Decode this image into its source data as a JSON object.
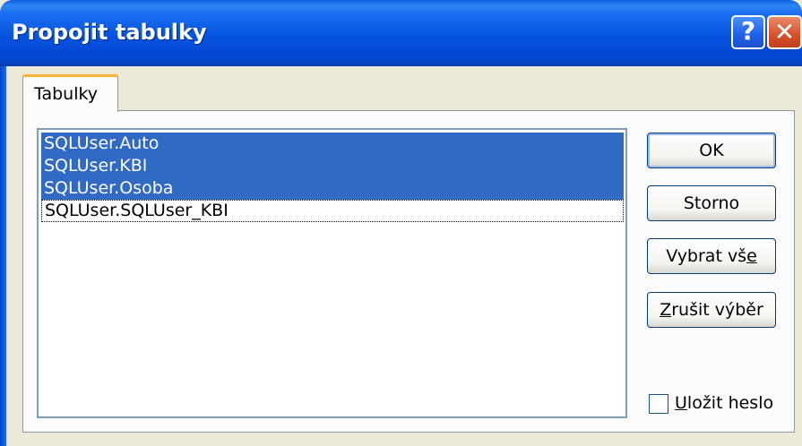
{
  "window": {
    "title": "Propojit tabulky",
    "help_glyph": "?",
    "close_glyph": "✕"
  },
  "tab": {
    "label": "Tabulky"
  },
  "list": {
    "items": [
      {
        "label": "SQLUser.Auto",
        "selected": true
      },
      {
        "label": "SQLUser.KBI",
        "selected": true
      },
      {
        "label": "SQLUser.Osoba",
        "selected": true
      },
      {
        "label": "SQLUser.SQLUser_KBI",
        "selected": false,
        "focused": true
      }
    ]
  },
  "buttons": {
    "ok": "OK",
    "cancel": "Storno",
    "select_all_pre": "Vybrat vš",
    "select_all_key": "e",
    "clear_key": "Z",
    "clear_post": "rušit výběr"
  },
  "checkbox": {
    "key": "U",
    "label_post": "ložit heslo",
    "checked": false
  },
  "colors": {
    "selection": "#316ac5",
    "titlebar": "#0553e0",
    "tab_accent": "#f7b33c",
    "face": "#ece9d8"
  }
}
